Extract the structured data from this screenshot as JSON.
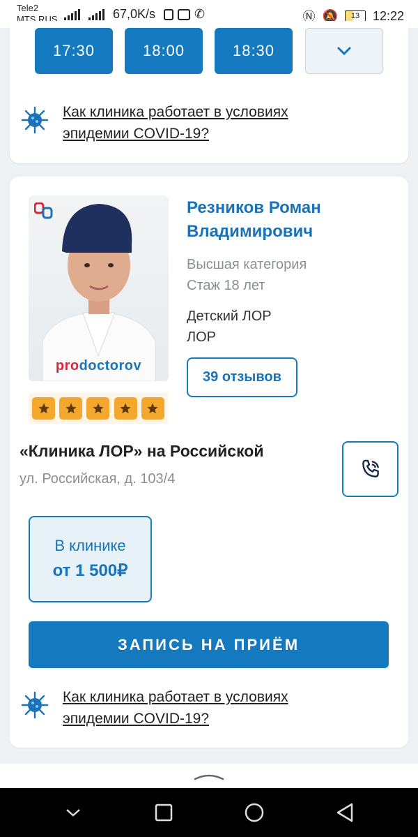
{
  "status": {
    "carrier1": "Tele2",
    "carrier2": "MTS RUS",
    "speed": "67,0K/s",
    "battery": "13",
    "time": "12:22"
  },
  "time_slots": [
    "17:30",
    "18:00",
    "18:30"
  ],
  "covid_link": "Как клиника работает в условиях эпидемии COVID-19?",
  "doctor": {
    "name": "Резников Роман Владимирович",
    "category": "Высшая категория",
    "experience": "Стаж 18 лет",
    "specialty1": "Детский ЛОР",
    "specialty2": "ЛОР",
    "reviews": "39 отзывов",
    "rating": 5,
    "photo_brand_pro": "pro",
    "photo_brand_doctorov": "doctorov"
  },
  "clinic": {
    "name": "«Клиника ЛОР» на Российской",
    "address": "ул. Российская, д. 103/4"
  },
  "price": {
    "label": "В клинике",
    "value": "от 1 500₽"
  },
  "book_label": "ЗАПИСЬ НА ПРИЁМ",
  "colors": {
    "primary": "#1479be",
    "star": "#f3a72c"
  }
}
